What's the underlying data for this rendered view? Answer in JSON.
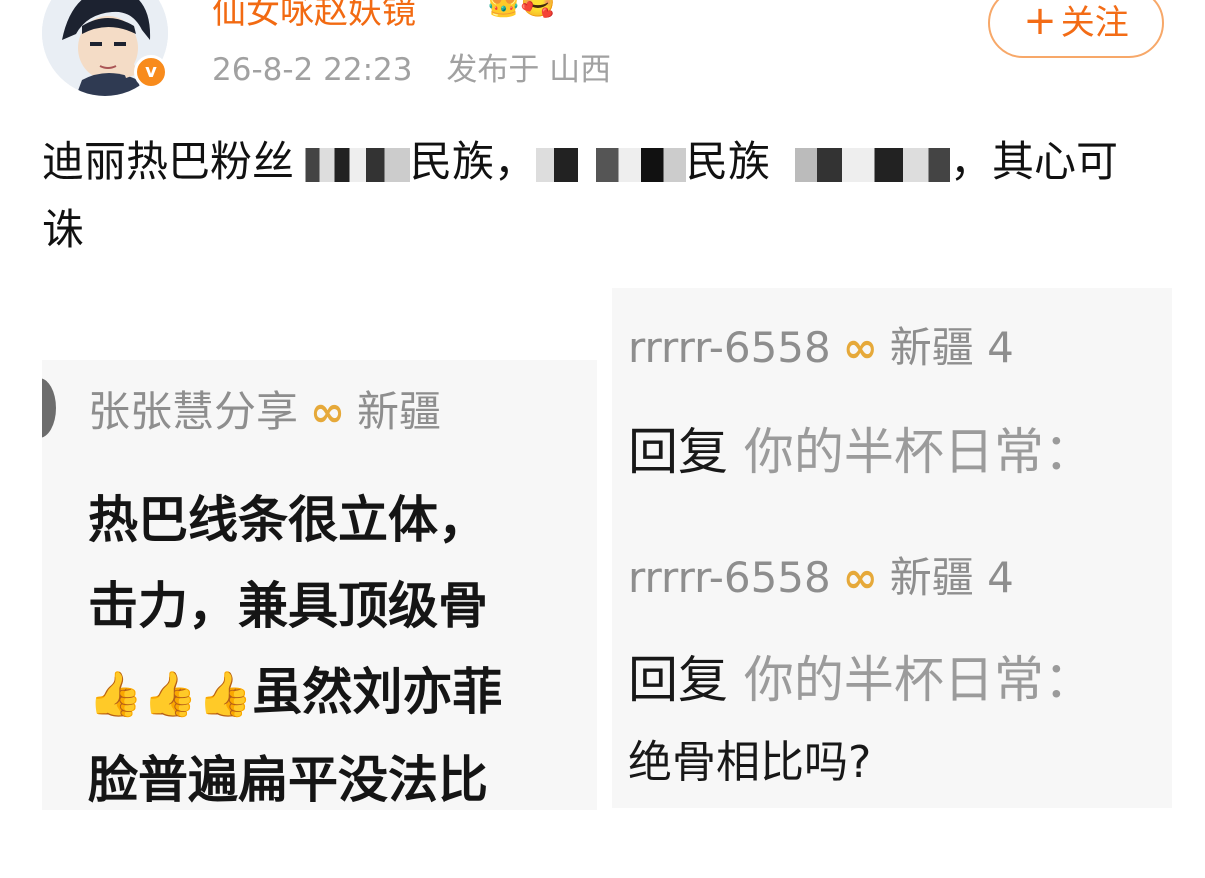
{
  "header": {
    "username": "仙女咏赵妖镜",
    "username_icons": "👑🥰",
    "timestamp": "26-8-2 22:23",
    "source_location": "发布于 山西",
    "follow_button": "关注",
    "follow_plus": "+",
    "verified_badge": "v"
  },
  "post": {
    "text_part1": "迪丽热巴粉丝",
    "text_part2": "民族，",
    "text_part3": "民族",
    "text_part4": "，其心可诛"
  },
  "left_screenshot": {
    "user": "张张慧分享",
    "badge_icon": "infinity-badge",
    "badge_glyph": "∞",
    "location": "新疆",
    "lines": [
      "热巴线条很立体，",
      "击力，兼具顶级骨",
      "虽然刘亦菲",
      "脸普遍扁平没法比"
    ],
    "thumb_emojis": "👍👍👍"
  },
  "right_screenshot": {
    "comments": [
      {
        "user": "rrrrr-6558",
        "badge_glyph": "∞",
        "location": "新疆 4",
        "reply_prefix": "回复",
        "reply_target": "你的半杯日常：",
        "reply_text": ""
      },
      {
        "user": "rrrrr-6558",
        "badge_glyph": "∞",
        "location": "新疆 4",
        "reply_prefix": "回复",
        "reply_target": "你的半杯日常：",
        "reply_text": "绝骨相比吗?"
      }
    ]
  },
  "colors": {
    "username": "#f26a12",
    "follow_border": "#f7a869",
    "meta": "#a1a1a1",
    "badge": "#e6a93a"
  }
}
